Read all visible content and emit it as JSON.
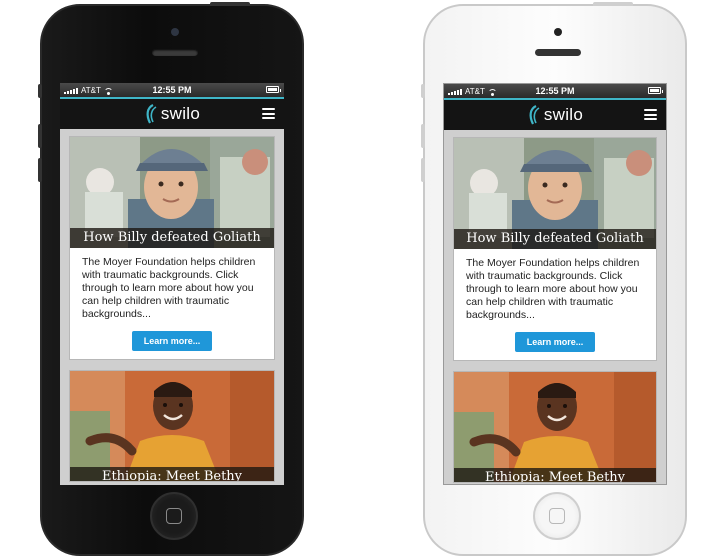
{
  "status_bar": {
    "carrier": "AT&T",
    "time": "12:55 PM"
  },
  "app": {
    "logo_text": "swilo",
    "accent_color": "#3fb6c8",
    "brand_dark": "#141414"
  },
  "cards": [
    {
      "title": "How Billy defeated Goliath",
      "body": "The Moyer Foundation helps children with traumatic backgrounds. Click through to learn more about how you can help children with traumatic backgrounds...",
      "button_label": "Learn more..."
    },
    {
      "title": "Ethiopia: Meet Bethy"
    }
  ],
  "icons": [
    "signal-icon",
    "wifi-icon",
    "battery-icon",
    "swilo-logo-icon",
    "menu-icon",
    "home-button-icon"
  ],
  "button_color": "#1f97d9"
}
